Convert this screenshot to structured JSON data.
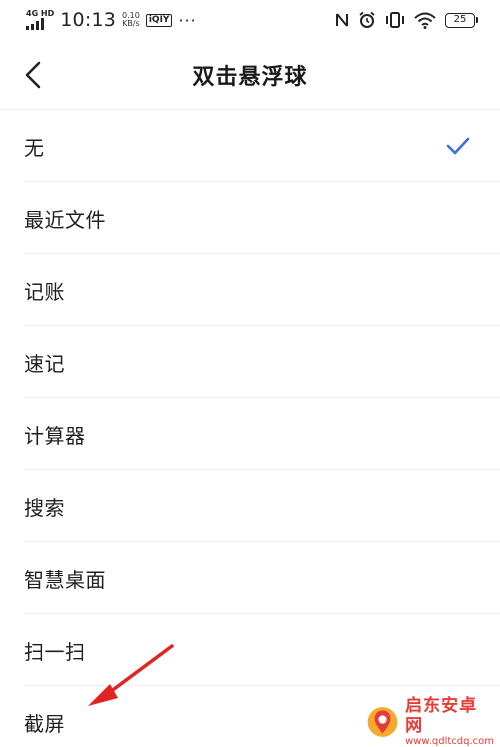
{
  "status_bar": {
    "network_type": "4G HD",
    "time": "10:13",
    "speed_value": "0.10",
    "speed_unit": "KB/s",
    "app_badge": "iQIY",
    "overflow": "···",
    "battery_level": "25",
    "icons": [
      "signal-icon",
      "nfc-icon",
      "alarm-icon",
      "vibrate-icon",
      "wifi-icon",
      "battery-icon"
    ]
  },
  "header": {
    "title": "双击悬浮球",
    "back_icon": "chevron-left-icon"
  },
  "options": [
    {
      "label": "无",
      "selected": true
    },
    {
      "label": "最近文件",
      "selected": false
    },
    {
      "label": "记账",
      "selected": false
    },
    {
      "label": "速记",
      "selected": false
    },
    {
      "label": "计算器",
      "selected": false
    },
    {
      "label": "搜索",
      "selected": false
    },
    {
      "label": "智慧桌面",
      "selected": false
    },
    {
      "label": "扫一扫",
      "selected": false
    },
    {
      "label": "截屏",
      "selected": false
    }
  ],
  "colors": {
    "accent": "#3a6fe0",
    "annotation": "#e02424",
    "watermark": "#e5322d"
  },
  "watermark": {
    "title": "启东安卓网",
    "url": "www.qdltcdq.com"
  }
}
